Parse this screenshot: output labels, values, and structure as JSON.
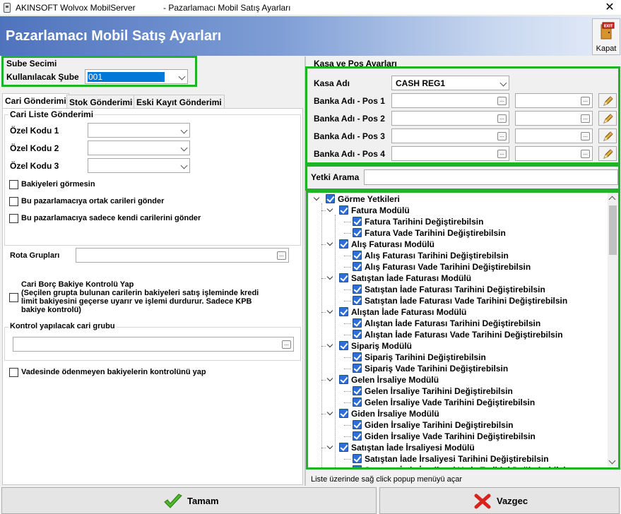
{
  "window": {
    "app_title": "AKINSOFT Wolvox MobilServer",
    "dialog_title": "- Pazarlamacı Mobil Satış Ayarları",
    "close_glyph": "✕"
  },
  "header": {
    "title": "Pazarlamacı Mobil Satış Ayarları",
    "kapat_label": "Kapat",
    "kapat_icon_text": "EXIT"
  },
  "sube": {
    "group_title": "Sube Secimi",
    "label": "Kullanılacak Şube",
    "value": "001"
  },
  "tabs": [
    {
      "label": "Cari Gönderimi",
      "active": true
    },
    {
      "label": "Stok Gönderimi",
      "active": false
    },
    {
      "label": "Eski Kayıt Gönderimi",
      "active": false
    }
  ],
  "cari": {
    "group_title": "Cari Liste Gönderimi",
    "ozel_kodu_1": "Özel Kodu 1",
    "ozel_kodu_2": "Özel Kodu 2",
    "ozel_kodu_3": "Özel Kodu 3",
    "cb_bakiyeleri": "Bakiyeleri görmesin",
    "cb_ortak": "Bu pazarlamacıya ortak carileri gönder",
    "cb_kendi": "Bu pazarlamacıya sadece kendi carilerini gönder",
    "rota_label": "Rota Grupları",
    "borc_line1": "Cari Borç Bakiye Kontrolü Yap",
    "borc_line2": "(Seçilen grupta bulunan carilerin bakiyeleri satış işleminde kredi",
    "borc_line3": "limit bakiyesini geçerse uyarır ve işlemi durdurur. Sadece KPB",
    "borc_line4": "bakiye kontrolü)",
    "kontrol_group_title": "Kontrol yapılacak cari grubu",
    "cb_vadesinde": "Vadesinde ödenmeyen bakiyelerin kontrolünü yap"
  },
  "kasa": {
    "group_title": "Kasa ve Pos Ayarları",
    "kasa_label": "Kasa Adı",
    "kasa_value": "CASH REG1",
    "banka1": "Banka Adı - Pos 1",
    "banka2": "Banka Adı - Pos 2",
    "banka3": "Banka Adı - Pos 3",
    "banka4": "Banka Adı - Pos 4"
  },
  "yetki": {
    "search_label": "Yetki Arama",
    "search_value": ""
  },
  "tree": [
    {
      "level": 0,
      "label": "Görme Yetkileri"
    },
    {
      "level": 1,
      "label": "Fatura Modülü"
    },
    {
      "level": 2,
      "label": "Fatura Tarihini Değiştirebilsin"
    },
    {
      "level": 2,
      "label": "Fatura Vade Tarihini Değiştirebilsin"
    },
    {
      "level": 1,
      "label": "Alış Faturası Modülü"
    },
    {
      "level": 2,
      "label": "Alış Faturası Tarihini Değiştirebilsin"
    },
    {
      "level": 2,
      "label": "Alış Faturası Vade Tarihini Değiştirebilsin"
    },
    {
      "level": 1,
      "label": "Satıştan İade Faturası Modülü"
    },
    {
      "level": 2,
      "label": "Satıştan İade Faturası Tarihini Değiştirebilsin"
    },
    {
      "level": 2,
      "label": "Satıştan İade Faturası Vade Tarihini Değiştirebilsin"
    },
    {
      "level": 1,
      "label": "Alıştan İade Faturası Modülü"
    },
    {
      "level": 2,
      "label": "Alıştan İade Faturası Tarihini Değiştirebilsin"
    },
    {
      "level": 2,
      "label": "Alıştan İade Faturası Vade Tarihini Değiştirebilsin"
    },
    {
      "level": 1,
      "label": "Sipariş Modülü"
    },
    {
      "level": 2,
      "label": "Sipariş Tarihini Değiştirebilsin"
    },
    {
      "level": 2,
      "label": "Sipariş Vade Tarihini Değiştirebilsin"
    },
    {
      "level": 1,
      "label": "Gelen İrsaliye Modülü"
    },
    {
      "level": 2,
      "label": "Gelen İrsaliye Tarihini Değiştirebilsin"
    },
    {
      "level": 2,
      "label": "Gelen İrsaliye Vade Tarihini Değiştirebilsin"
    },
    {
      "level": 1,
      "label": "Giden İrsaliye Modülü"
    },
    {
      "level": 2,
      "label": "Giden İrsaliye Tarihini Değiştirebilsin"
    },
    {
      "level": 2,
      "label": "Giden İrsaliye Vade Tarihini Değiştirebilsin"
    },
    {
      "level": 1,
      "label": "Satıştan İade İrsaliyesi Modülü"
    },
    {
      "level": 2,
      "label": "Satıştan İade İrsaliyesi Tarihini Değiştirebilsin"
    },
    {
      "level": 2,
      "label": "Satıştan İade İrsaliyesi Vade Tarihini Değiştirebilsin"
    }
  ],
  "status_text": "Liste üzerinde sağ click popup menüyü açar",
  "buttons": {
    "ok": "Tamam",
    "cancel": "Vazgec"
  },
  "colors": {
    "highlight": "#1fb327",
    "selection": "#0078d7",
    "checkbox": "#2e6fd4"
  }
}
